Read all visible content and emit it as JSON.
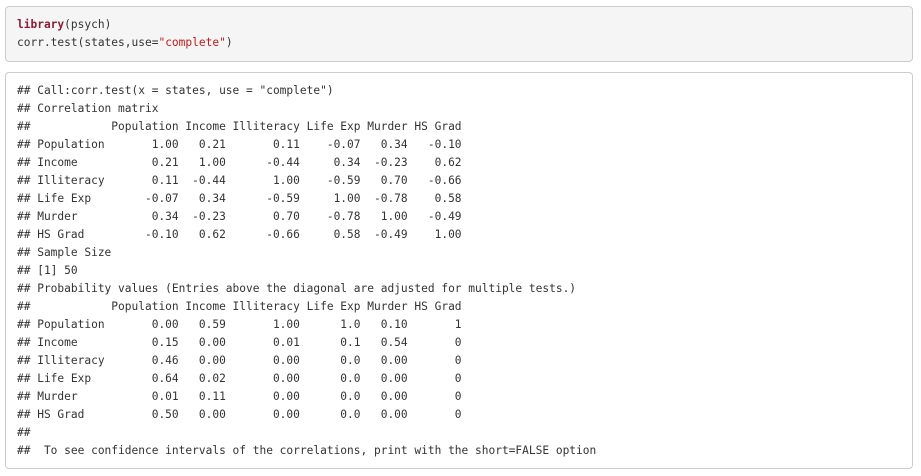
{
  "input_code": {
    "line1_keyword": "library",
    "line1_rest": "(psych)",
    "line2_prefix": "corr.test(states,use=",
    "line2_string": "\"complete\"",
    "line2_suffix": ")"
  },
  "output_lines": [
    "## Call:corr.test(x = states, use = \"complete\")",
    "## Correlation matrix",
    "##            Population Income Illiteracy Life Exp Murder HS Grad",
    "## Population       1.00   0.21       0.11    -0.07   0.34   -0.10",
    "## Income           0.21   1.00      -0.44     0.34  -0.23    0.62",
    "## Illiteracy       0.11  -0.44       1.00    -0.59   0.70   -0.66",
    "## Life Exp        -0.07   0.34      -0.59     1.00  -0.78    0.58",
    "## Murder           0.34  -0.23       0.70    -0.78   1.00   -0.49",
    "## HS Grad         -0.10   0.62      -0.66     0.58  -0.49    1.00",
    "## Sample Size",
    "## [1] 50",
    "## Probability values (Entries above the diagonal are adjusted for multiple tests.)",
    "##            Population Income Illiteracy Life Exp Murder HS Grad",
    "## Population       0.00   0.59       1.00      1.0   0.10       1",
    "## Income           0.15   0.00       0.01      0.1   0.54       0",
    "## Illiteracy       0.46   0.00       0.00      0.0   0.00       0",
    "## Life Exp         0.64   0.02       0.00      0.0   0.00       0",
    "## Murder           0.01   0.11       0.00      0.0   0.00       0",
    "## HS Grad          0.50   0.00       0.00      0.0   0.00       0",
    "##",
    "##  To see confidence intervals of the correlations, print with the short=FALSE option"
  ]
}
